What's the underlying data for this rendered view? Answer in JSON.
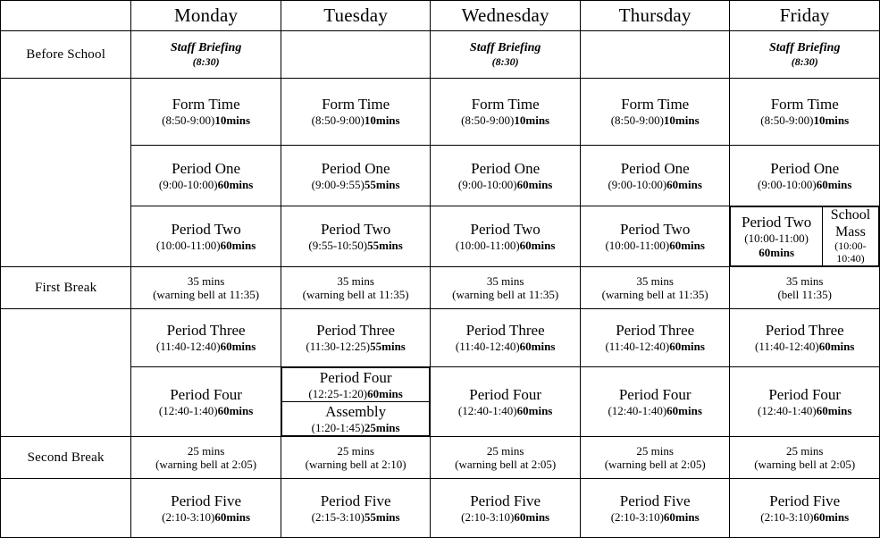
{
  "table": {
    "corner_label": "",
    "day_headers": [
      "Monday",
      "Tuesday",
      "Wednesday",
      "Thursday",
      "Friday"
    ],
    "row_labels": {
      "before_school": "Before School",
      "form_time": "",
      "period_one": "",
      "period_two": "",
      "first_break": "First Break",
      "period_three": "",
      "period_four": "",
      "second_break": "Second Break",
      "period_five": ""
    },
    "rows": {
      "before_school": {
        "monday": {
          "title": "Staff Briefing",
          "sub": "(8:30)"
        },
        "tuesday": {
          "title": "",
          "sub": ""
        },
        "wednesday": {
          "title": "Staff Briefing",
          "sub": "(8:30)"
        },
        "thursday": {
          "title": "",
          "sub": ""
        },
        "friday": {
          "title": "Staff Briefing",
          "sub": "(8:30)"
        }
      },
      "form_time": {
        "monday": {
          "title": "Form Time",
          "sub_plain": "(8:50-9:00)",
          "sub_bold": "10mins"
        },
        "tuesday": {
          "title": "Form Time",
          "sub_plain": "(8:50-9:00)",
          "sub_bold": "10mins"
        },
        "wednesday": {
          "title": "Form Time",
          "sub_plain": "(8:50-9:00)",
          "sub_bold": "10mins"
        },
        "thursday": {
          "title": "Form Time",
          "sub_plain": "(8:50-9:00)",
          "sub_bold": "10mins"
        },
        "friday": {
          "title": "Form Time",
          "sub_plain": "(8:50-9:00)",
          "sub_bold": "10mins"
        }
      },
      "period_one": {
        "monday": {
          "title": "Period One",
          "sub_plain": "(9:00-10:00)",
          "sub_bold": "60mins"
        },
        "tuesday": {
          "title": "Period One",
          "sub_plain": "(9:00-9:55)",
          "sub_bold": "55mins"
        },
        "wednesday": {
          "title": "Period One",
          "sub_plain": "(9:00-10:00)",
          "sub_bold": "60mins"
        },
        "thursday": {
          "title": "Period One",
          "sub_plain": "(9:00-10:00)",
          "sub_bold": "60mins"
        },
        "friday": {
          "title": "Period One",
          "sub_plain": "(9:00-10:00)",
          "sub_bold": "60mins"
        }
      },
      "period_two": {
        "monday": {
          "title": "Period Two",
          "sub_plain": "(10:00-11:00)",
          "sub_bold": "60mins"
        },
        "tuesday": {
          "title": "Period Two",
          "sub_plain": "(9:55-10:50)",
          "sub_bold": "55mins"
        },
        "wednesday": {
          "title": "Period Two",
          "sub_plain": "(10:00-11:00)",
          "sub_bold": "60mins"
        },
        "thursday": {
          "title": "Period Two",
          "sub_plain": "(10:00-11:00)",
          "sub_bold": "60mins"
        },
        "friday": {
          "title": "Period Two",
          "sub_plain": "(10:00-11:00)",
          "sub_bold": "60mins"
        },
        "friday_extra": {
          "title": "School Mass",
          "sub": "(10:00-10:40)"
        }
      },
      "first_break": {
        "monday": {
          "title": "35 mins",
          "sub": "(warning bell at 11:35)"
        },
        "tuesday": {
          "title": "35 mins",
          "sub": "(warning bell at 11:35)"
        },
        "wednesday": {
          "title": "35 mins",
          "sub": "(warning bell at 11:35)"
        },
        "thursday": {
          "title": "35 mins",
          "sub": "(warning bell at 11:35)"
        },
        "friday": {
          "title": "35 mins",
          "sub": "(bell 11:35)"
        }
      },
      "period_three": {
        "monday": {
          "title": "Period Three",
          "sub_plain": "(11:40-12:40)",
          "sub_bold": "60mins"
        },
        "tuesday": {
          "title": "Period Three",
          "sub_plain": "(11:30-12:25)",
          "sub_bold": "55mins"
        },
        "wednesday": {
          "title": "Period Three",
          "sub_plain": "(11:40-12:40)",
          "sub_bold": "60mins"
        },
        "thursday": {
          "title": "Period Three",
          "sub_plain": "(11:40-12:40)",
          "sub_bold": "60mins"
        },
        "friday": {
          "title": "Period Three",
          "sub_plain": "(11:40-12:40)",
          "sub_bold": "60mins"
        }
      },
      "period_four": {
        "monday": {
          "title": "Period Four",
          "sub_plain": "(12:40-1:40)",
          "sub_bold": "60mins"
        },
        "tuesday": {
          "title": "Period Four",
          "sub_plain": "(12:25-1:20)",
          "sub_bold": "60mins"
        },
        "tuesday_extra": {
          "title": "Assembly",
          "sub_plain": "(1:20-1:45)",
          "sub_bold": "25mins"
        },
        "wednesday": {
          "title": "Period Four",
          "sub_plain": "(12:40-1:40)",
          "sub_bold": "60mins"
        },
        "thursday": {
          "title": "Period Four",
          "sub_plain": "(12:40-1:40)",
          "sub_bold": "60mins"
        },
        "friday": {
          "title": "Period Four",
          "sub_plain": "(12:40-1:40)",
          "sub_bold": "60mins"
        }
      },
      "second_break": {
        "monday": {
          "title": "25 mins",
          "sub": "(warning bell at 2:05)"
        },
        "tuesday": {
          "title": "25 mins",
          "sub": "(warning bell at 2:10)"
        },
        "wednesday": {
          "title": "25 mins",
          "sub": "(warning bell at 2:05)"
        },
        "thursday": {
          "title": "25 mins",
          "sub": "(warning bell at 2:05)"
        },
        "friday": {
          "title": "25 mins",
          "sub": "(warning bell at 2:05)"
        }
      },
      "period_five": {
        "monday": {
          "title": "Period Five",
          "sub_plain": "(2:10-3:10)",
          "sub_bold": "60mins"
        },
        "tuesday": {
          "title": "Period Five",
          "sub_plain": "(2:15-3:10)",
          "sub_bold": "55mins"
        },
        "wednesday": {
          "title": "Period Five",
          "sub_plain": "(2:10-3:10)",
          "sub_bold": "60mins"
        },
        "thursday": {
          "title": "Period Five",
          "sub_plain": "(2:10-3:10)",
          "sub_bold": "60mins"
        },
        "friday": {
          "title": "Period Five",
          "sub_plain": "(2:10-3:10)",
          "sub_bold": "60mins"
        }
      }
    }
  },
  "colors": {
    "border": "#000000",
    "background": "#ffffff",
    "text": "#000000"
  }
}
